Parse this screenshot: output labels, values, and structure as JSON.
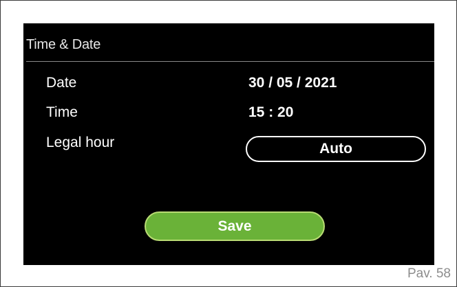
{
  "screen": {
    "title": "Time & Date",
    "rows": {
      "date": {
        "label": "Date",
        "value": "30 / 05 / 2021"
      },
      "time": {
        "label": "Time",
        "value": "15 : 20"
      },
      "legal_hour": {
        "label": "Legal hour",
        "value": "Auto"
      }
    },
    "save_label": "Save"
  },
  "page_number": "Pav. 58",
  "colors": {
    "screen_background": "#000000",
    "save_button": "#6ab238",
    "save_button_border": "#b9dc74",
    "text": "#ffffff"
  }
}
